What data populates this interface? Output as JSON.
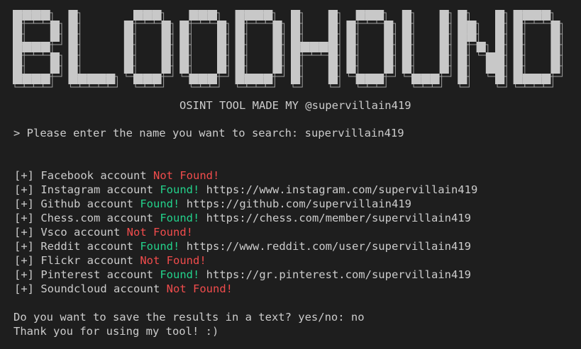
{
  "banner": {
    "text": "BLOODHOUND"
  },
  "subtitle": "OSINT TOOL MADE MY @supervillain419",
  "prompt": {
    "label": "> Please enter the name you want to search: ",
    "value": "supervillain419"
  },
  "results": [
    {
      "prefix": "[+]",
      "name": "Facebook account",
      "status": "Not Found!",
      "found": false,
      "url": ""
    },
    {
      "prefix": "[+]",
      "name": "Instagram account",
      "status": "Found!",
      "found": true,
      "url": "https://www.instagram.com/supervillain419"
    },
    {
      "prefix": "[+]",
      "name": "Github account",
      "status": "Found!",
      "found": true,
      "url": "https://github.com/supervillain419"
    },
    {
      "prefix": "[+]",
      "name": "Chess.com account",
      "status": "Found!",
      "found": true,
      "url": "https://chess.com/member/supervillain419"
    },
    {
      "prefix": "[+]",
      "name": "Vsco account",
      "status": "Not Found!",
      "found": false,
      "url": ""
    },
    {
      "prefix": "[+]",
      "name": "Reddit account",
      "status": "Found!",
      "found": true,
      "url": "https://www.reddit.com/user/supervillain419"
    },
    {
      "prefix": "[+]",
      "name": "Flickr account",
      "status": "Not Found!",
      "found": false,
      "url": ""
    },
    {
      "prefix": "[+]",
      "name": "Pinterest account",
      "status": "Found!",
      "found": true,
      "url": "https://gr.pinterest.com/supervillain419"
    },
    {
      "prefix": "[+]",
      "name": "Soundcloud account",
      "status": "Not Found!",
      "found": false,
      "url": ""
    }
  ],
  "save_prompt": {
    "label": "Do you want to save the results in a text? yes/no: ",
    "value": "no"
  },
  "farewell": "Thank you for using my tool! :)",
  "colors": {
    "background": "#1e1e1e",
    "text": "#cccccc",
    "found": "#23d18b",
    "not_found": "#f14c4c",
    "banner_fill": "#c8c8c8",
    "banner_outline": "#a0a0a0"
  }
}
